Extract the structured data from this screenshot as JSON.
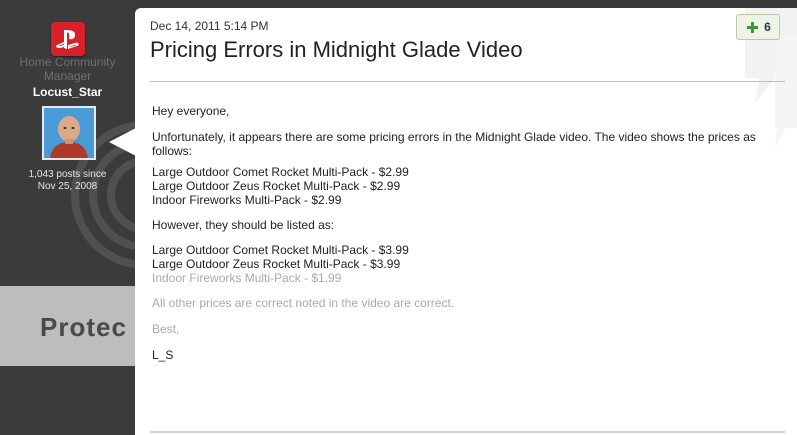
{
  "sidebar": {
    "role": "Home Community Manager",
    "username": "Locust_Star",
    "post_count": "1,043 posts since",
    "joined": "Nov 25, 2008",
    "background_text": "Protec"
  },
  "post": {
    "date": "Dec 14, 2011 5:14 PM",
    "title": "Pricing Errors in Midnight Glade Video",
    "kudos_count": "6",
    "lines": {
      "greeting": "Hey everyone,",
      "intro": "Unfortunately, it appears there  are some pricing errors in the Midnight Glade video.  The video shows the prices as follows:",
      "wrong1": "Large Outdoor Comet Rocket Multi-Pack - $2.99",
      "wrong2": "Large Outdoor Zeus Rocket Multi-Pack - $2.99",
      "wrong3": "Indoor Fireworks Multi-Pack - $2.99",
      "however": "However, they should be listed as:",
      "right1": "Large Outdoor Comet Rocket Multi-Pack - $3.99",
      "right2": "Large Outdoor Zeus Rocket Multi-Pack - $3.99",
      "right3": "Indoor Fireworks Multi-Pack - $1.99",
      "other": "All other prices are correct noted in the video are correct.",
      "closing": "Best,",
      "signature": "L_S"
    }
  },
  "colors": {
    "brand_red": "#d8202a",
    "kudos_green": "#3a9a3a"
  },
  "icons": {
    "logo": "playstation-logo-icon",
    "kudos": "kudos-plus-icon"
  }
}
